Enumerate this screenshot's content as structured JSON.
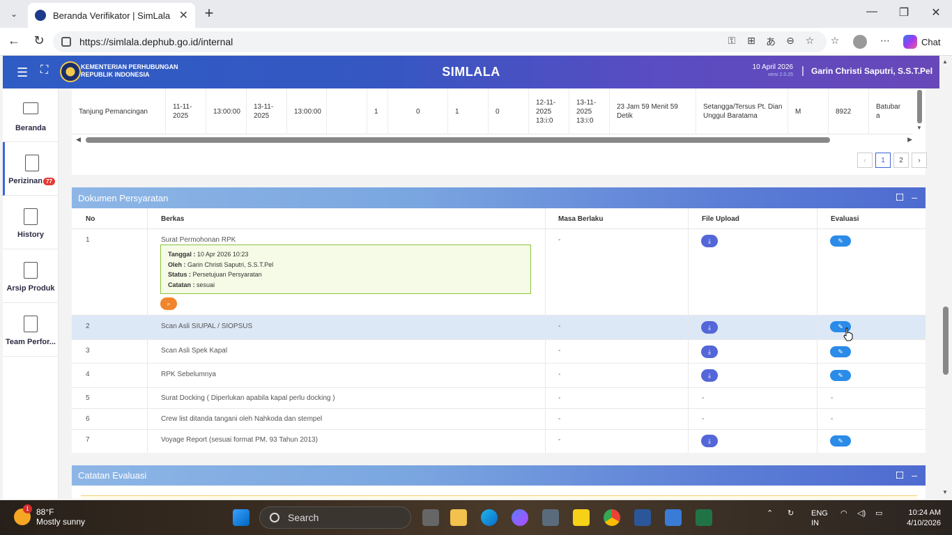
{
  "browser": {
    "tab_title": "Beranda Verifikator | SimLala",
    "url": "https://simlala.dephub.go.id/internal",
    "chat_label": "Chat"
  },
  "header": {
    "org_line1": "KEMENTERIAN PERHUBUNGAN",
    "org_line2": "REPUBLIK INDONESIA",
    "app_title": "SIMLALA",
    "date": "10 April 2026",
    "version": "versi 2.0.25",
    "separator": "|",
    "user": "Garin Christi Saputri, S.S.T.Pel"
  },
  "sidebar": {
    "items": [
      {
        "label": "Beranda",
        "icon": "monitor-icon"
      },
      {
        "label": "Perizinan",
        "icon": "document-icon",
        "badge": "77"
      },
      {
        "label": "History",
        "icon": "document-icon"
      },
      {
        "label": "Arsip Produk",
        "icon": "document-icon"
      },
      {
        "label": "Team Perfor...",
        "icon": "document-icon"
      }
    ]
  },
  "top_row": {
    "cells": [
      "Tanjung Pemancingan",
      "11-11-\n2025",
      "13:00:00",
      "13-11-\n2025",
      "13:00:00",
      "",
      "1",
      "0",
      "1",
      "0",
      "12-11-\n2025\n13:i:0",
      "13-11-\n2025\n13:i:0",
      "23 Jam 59 Menit 59\nDetik",
      "Setangga/Tersus Pt. Dian\nUnggul Baratama",
      "M",
      "8922",
      "Batubar\na"
    ]
  },
  "pagination": {
    "prev": "‹",
    "pages": [
      "1",
      "2"
    ],
    "next": "›",
    "active": "1"
  },
  "dokumen": {
    "title": "Dokumen Persyaratan",
    "columns": {
      "no": "No",
      "berkas": "Berkas",
      "masa": "Masa Berlaku",
      "upload": "File Upload",
      "evaluasi": "Evaluasi"
    },
    "rows": [
      {
        "no": "1",
        "berkas": "Surat Permohonan RPK",
        "masa": "-",
        "upload": "",
        "evaluasi": ""
      },
      {
        "no": "2",
        "berkas": "Scan Asli SIUPAL / SIOPSUS",
        "masa": "-",
        "upload": "",
        "evaluasi": ""
      },
      {
        "no": "3",
        "berkas": "Scan Asli Spek Kapal",
        "masa": "-",
        "upload": "",
        "evaluasi": ""
      },
      {
        "no": "4",
        "berkas": "RPK Sebelumnya",
        "masa": "-",
        "upload": "",
        "evaluasi": ""
      },
      {
        "no": "5",
        "berkas": "Surat Docking ( Diperlukan apabila kapal perlu docking )",
        "masa": "-",
        "upload": "-",
        "evaluasi": "-"
      },
      {
        "no": "6",
        "berkas": "Crew list ditanda tangani oleh Nahkoda dan stempel",
        "masa": "-",
        "upload": "-",
        "evaluasi": "-"
      },
      {
        "no": "7",
        "berkas": "Voyage Report (sesuai format PM. 93 Tahun 2013)",
        "masa": "-",
        "upload": "",
        "evaluasi": ""
      }
    ],
    "row1_info": {
      "tanggal_label": "Tanggal :",
      "tanggal": "10 Apr 2026 10:23",
      "oleh_label": "Oleh :",
      "oleh": "Garin Christi Saputri, S.S.T.Pel",
      "status_label": "Status :",
      "status": "Persetujuan Persyaratan",
      "catatan_label": "Catatan :",
      "catatan": "sesuai"
    }
  },
  "catatan": {
    "title": "Catatan Evaluasi"
  },
  "taskbar": {
    "weather_badge": "1",
    "temp": "88°F",
    "weather": "Mostly sunny",
    "search": "Search",
    "lang1": "ENG",
    "lang2": "IN",
    "time": "10:24 AM",
    "date": "4/10/2026"
  },
  "colors": {
    "header_gradient_start": "#2f5cc4",
    "header_gradient_end": "#6848b8",
    "card_head_start": "#8db6e6",
    "card_head_end": "#4e6bd0",
    "download_btn": "#5367d8",
    "evaluate_btn": "#2b8be8",
    "search_btn": "#f0852d",
    "badge": "#e53935",
    "info_border": "#8ec13a"
  }
}
